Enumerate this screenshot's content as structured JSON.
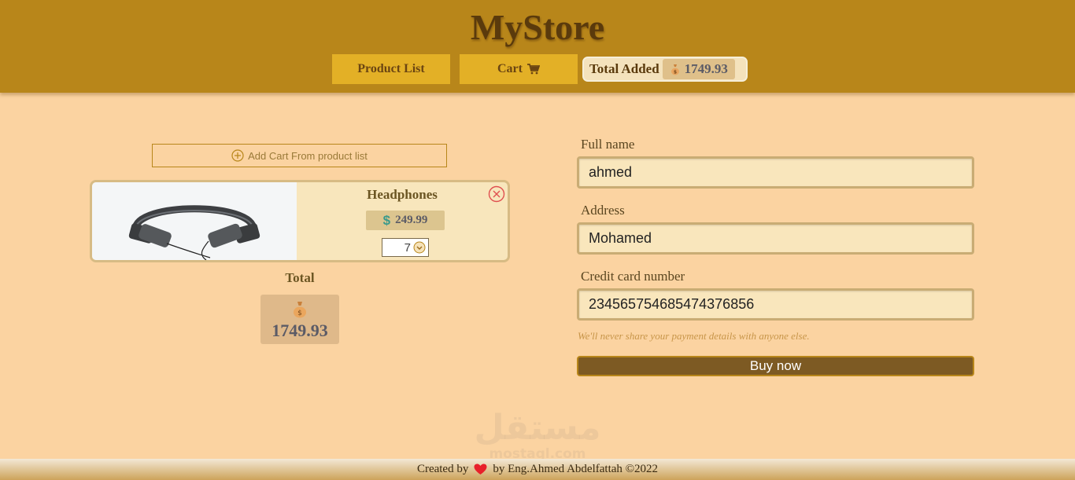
{
  "header": {
    "brand": "MyStore",
    "nav": {
      "product_list": "Product List",
      "cart": "Cart"
    },
    "total_added_label": "Total Added",
    "total_added_value": "1749.93"
  },
  "cart": {
    "add_button": "Add Cart From product list",
    "items": [
      {
        "name": "Headphones",
        "price": "249.99",
        "quantity": "7"
      }
    ],
    "total_label": "Total",
    "total_value": "1749.93"
  },
  "form": {
    "full_name_label": "Full name",
    "full_name_value": "ahmed",
    "address_label": "Address",
    "address_value": "Mohamed",
    "card_label": "Credit card number",
    "card_value": "234565754685474376856",
    "hint": "We'll never share your payment details with anyone else.",
    "buy_button": "Buy now"
  },
  "watermark": {
    "text": "مستقل",
    "sub": "mostaql.com"
  },
  "footer": {
    "created_by": "Created by",
    "author": "by Eng.Ahmed Abdelfattah ©2022"
  },
  "colors": {
    "header_bg": "#b8861a",
    "nav_button": "#e3b026",
    "page_bg": "#fbd3a1",
    "buy_button": "#7d5a23",
    "heart": "#e8202a"
  },
  "icons": [
    "cart-icon",
    "money-bag-icon",
    "plus-circle-icon",
    "dollar-icon",
    "chevron-down-icon",
    "close-circle-icon",
    "heart-icon"
  ]
}
